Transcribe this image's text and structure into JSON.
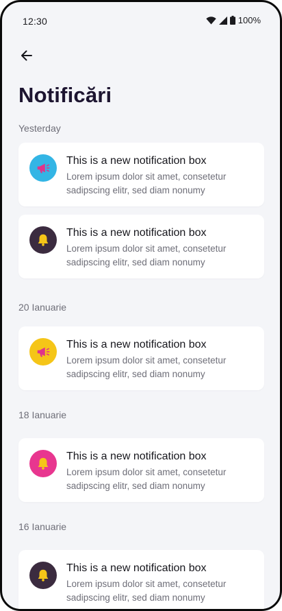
{
  "status_bar": {
    "time": "12:30",
    "battery": "100%",
    "icons": [
      "wifi-icon",
      "signal-icon",
      "battery-icon"
    ]
  },
  "header": {
    "back_icon": "arrow-left-icon",
    "title": "Notificări"
  },
  "sections": [
    {
      "label": "Yesterday",
      "items": [
        {
          "icon": "megaphone-icon",
          "icon_bg": "#33b5e5",
          "icon_fg": "#e0338a",
          "title": "This is a new notification box",
          "body": "Lorem ipsum dolor sit amet, consetetur sadipscing elitr, sed diam nonumy"
        },
        {
          "icon": "bell-icon",
          "icon_bg": "#3b2b3f",
          "icon_fg": "#f5c518",
          "title": "This is a new notification box",
          "body": "Lorem ipsum dolor sit amet, consetetur sadipscing elitr, sed diam nonumy"
        }
      ]
    },
    {
      "label": "20 Ianuarie",
      "items": [
        {
          "icon": "megaphone-icon",
          "icon_bg": "#f5c518",
          "icon_fg": "#e0338a",
          "title": "This is a new notification box",
          "body": "Lorem ipsum dolor sit amet, consetetur sadipscing elitr, sed diam nonumy"
        }
      ]
    },
    {
      "label": "18 Ianuarie",
      "items": [
        {
          "icon": "bell-icon",
          "icon_bg": "#e8368f",
          "icon_fg": "#f5c518",
          "title": "This is a new notification box",
          "body": "Lorem ipsum dolor sit amet, consetetur sadipscing elitr, sed diam nonumy"
        }
      ]
    },
    {
      "label": "16 Ianuarie",
      "items": [
        {
          "icon": "bell-icon",
          "icon_bg": "#3b2b3f",
          "icon_fg": "#f5c518",
          "title": "This is a new notification box",
          "body": "Lorem ipsum dolor sit amet, consetetur sadipscing elitr, sed diam nonumy"
        }
      ]
    }
  ]
}
